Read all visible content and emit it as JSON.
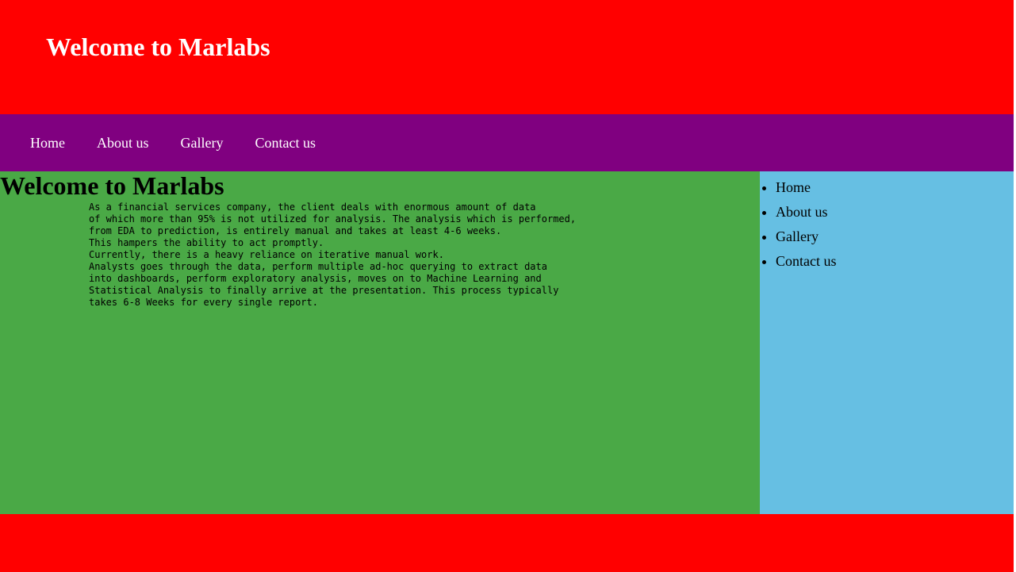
{
  "header": {
    "title": "Welcome to Marlabs"
  },
  "topnav": {
    "items": [
      {
        "label": "Home"
      },
      {
        "label": "About us"
      },
      {
        "label": "Gallery"
      },
      {
        "label": "Contact us"
      }
    ]
  },
  "main": {
    "heading": "Welcome to Marlabs",
    "lines": [
      "As a financial services company, the client deals with enormous amount of data",
      "of which more than 95% is not utilized for analysis. The analysis which is performed,",
      "from EDA to prediction, is entirely manual and takes at least 4-6 weeks.",
      "This hampers the ability to act promptly.",
      "Currently, there is a heavy reliance on iterative manual work.",
      "Analysts goes through the data, perform multiple ad-hoc querying to extract data",
      "into dashboards, perform exploratory analysis, moves on to Machine Learning and",
      "Statistical Analysis to finally arrive at the presentation. This process typically",
      "takes 6-8 Weeks for every single report."
    ]
  },
  "sidebar": {
    "items": [
      {
        "label": "Home"
      },
      {
        "label": "About us"
      },
      {
        "label": "Gallery"
      },
      {
        "label": "Contact us"
      }
    ]
  },
  "colors": {
    "header_bg": "#ff0000",
    "nav_bg": "#800080",
    "main_bg": "#4aa946",
    "sidebar_bg": "#66bfe3",
    "footer_bg": "#ff0000"
  }
}
